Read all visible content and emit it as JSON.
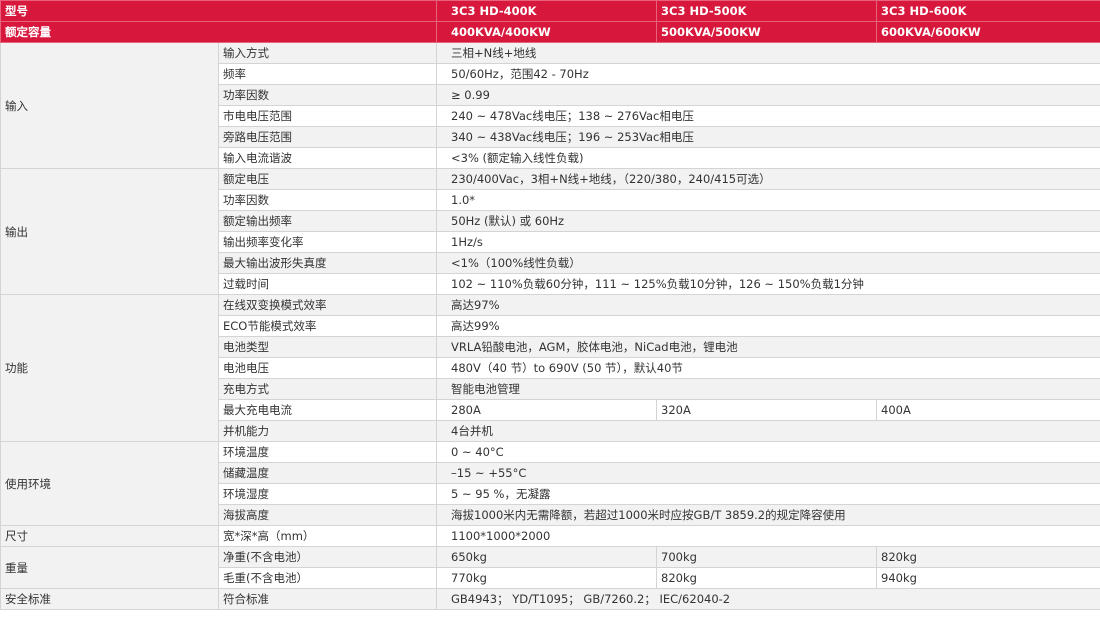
{
  "header": {
    "model_label": "型号",
    "models": [
      "3C3 HD-400K",
      "3C3 HD-500K",
      "3C3 HD-600K"
    ],
    "capacity_label": "额定容量",
    "capacities": [
      "400KVA/400KW",
      "500KVA/500KW",
      "600KVA/600KW"
    ]
  },
  "input": {
    "category": "输入",
    "rows": [
      {
        "label": "输入方式",
        "value": "三相+N线+地线"
      },
      {
        "label": "频率",
        "value": "50/60Hz，范围42 - 70Hz"
      },
      {
        "label": "功率因数",
        "value": "≥ 0.99"
      },
      {
        "label": "市电电压范围",
        "value": "240 ~ 478Vac线电压；138 ~ 276Vac相电压"
      },
      {
        "label": "旁路电压范围",
        "value": "340 ~ 438Vac线电压；196 ~ 253Vac相电压"
      },
      {
        "label": "输入电流谐波",
        "value": "<3% (额定输入线性负载)"
      }
    ]
  },
  "output": {
    "category": "输出",
    "rows": [
      {
        "label": "额定电压",
        "value": "230/400Vac，3相+N线+地线，（220/380，240/415可选）"
      },
      {
        "label": "功率因数",
        "value": "1.0*"
      },
      {
        "label": "额定输出频率",
        "value": "50Hz (默认) 或 60Hz"
      },
      {
        "label": "输出频率变化率",
        "value": "1Hz/s"
      },
      {
        "label": "最大输出波形失真度",
        "value": "<1%（100%线性负载）"
      },
      {
        "label": "过载时间",
        "value": "102 ~ 110%负载60分钟，111 ~ 125%负载10分钟，126 ~ 150%负载1分钟"
      }
    ]
  },
  "function": {
    "category": "功能",
    "rows": [
      {
        "label": "在线双变换模式效率",
        "value": "高达97%"
      },
      {
        "label": "ECO节能模式效率",
        "value": "高达99%"
      },
      {
        "label": "电池类型",
        "value": "VRLA铅酸电池，AGM，胶体电池，NiCad电池，锂电池"
      },
      {
        "label": "电池电压",
        "value": "480V（40 节）to 690V (50 节），默认40节"
      },
      {
        "label": "充电方式",
        "value": "智能电池管理"
      }
    ],
    "max_charge": {
      "label": "最大充电电流",
      "values": [
        "280A",
        "320A",
        "400A"
      ]
    },
    "parallel": {
      "label": "并机能力",
      "value": "4台并机"
    }
  },
  "environment": {
    "category": "使用环境",
    "rows": [
      {
        "label": "环境温度",
        "value": "0 ~ 40°C"
      },
      {
        "label": "储藏温度",
        "value": "–15 ~ +55°C"
      },
      {
        "label": "环境湿度",
        "value": "5 ~ 95 %，无凝露"
      },
      {
        "label": "海拔高度",
        "value": "海拔1000米内无需降额，若超过1000米时应按GB/T 3859.2的规定降容使用"
      }
    ]
  },
  "size": {
    "category": "尺寸",
    "label": "宽*深*高（mm）",
    "value": "1100*1000*2000"
  },
  "weight": {
    "category": "重量",
    "net": {
      "label": "净重(不含电池）",
      "values": [
        "650kg",
        "700kg",
        "820kg"
      ]
    },
    "gross": {
      "label": "毛重(不含电池）",
      "values": [
        "770kg",
        "820kg",
        "940kg"
      ]
    }
  },
  "safety": {
    "category": "安全标准",
    "label": "符合标准",
    "value": "GB4943； YD/T1095； GB/7260.2； IEC/62040-2"
  },
  "colors": {
    "header_bg": "#d7183c",
    "row_alt": "#f2f2f2",
    "border": "#d4d4d4"
  }
}
